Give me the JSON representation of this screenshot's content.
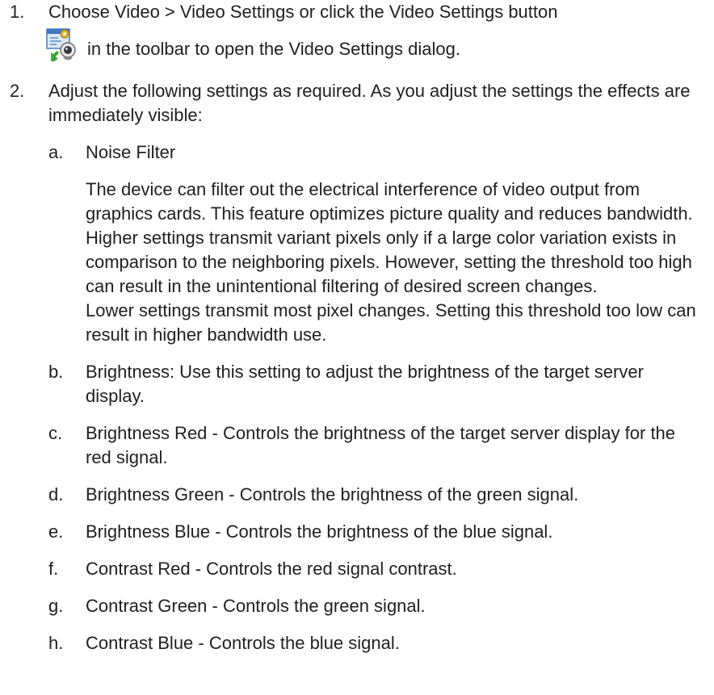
{
  "steps": [
    {
      "num": "1.",
      "line1": "Choose Video > Video Settings or click the Video Settings button",
      "line2": "in the toolbar to open the Video Settings dialog.",
      "icon": "video-settings-icon"
    },
    {
      "num": "2.",
      "text": "Adjust the following settings as required. As you adjust the settings the effects are immediately visible:"
    }
  ],
  "settings": [
    {
      "letter": "a.",
      "title": "Noise Filter",
      "para1": "The device can filter out the electrical interference of video output from graphics cards. This feature optimizes picture quality and reduces bandwidth. Higher settings transmit variant pixels only if a large color variation exists in comparison to the neighboring pixels. However, setting the threshold too high can result in the unintentional filtering of desired screen changes.",
      "para2": "Lower settings transmit most pixel changes. Setting this threshold too low can result in higher bandwidth use."
    },
    {
      "letter": "b.",
      "text": "Brightness: Use this setting to adjust the brightness of the target server display."
    },
    {
      "letter": "c.",
      "text": "Brightness Red - Controls the brightness of the target server display for the red signal."
    },
    {
      "letter": "d.",
      "text": "Brightness Green - Controls the brightness of the green signal."
    },
    {
      "letter": "e.",
      "text": "Brightness Blue - Controls the brightness of the blue signal."
    },
    {
      "letter": "f.",
      "text": "Contrast Red - Controls the red signal contrast."
    },
    {
      "letter": "g.",
      "text": "Contrast Green - Controls the green signal."
    },
    {
      "letter": "h.",
      "text": "Contrast Blue - Controls the blue signal."
    }
  ]
}
